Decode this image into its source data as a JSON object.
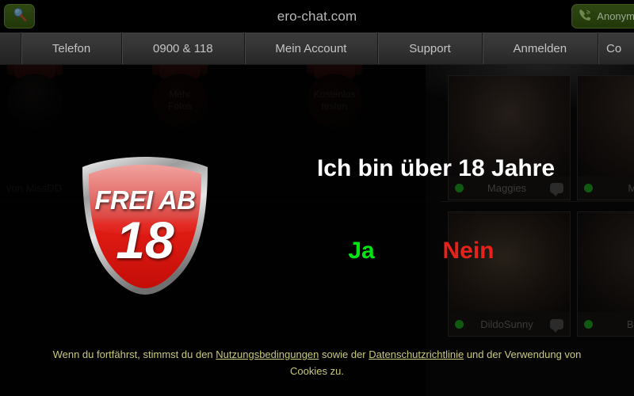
{
  "browser": {
    "title": "ero-chat.com",
    "left_chip": {
      "icon": "search-icon",
      "label": ""
    },
    "right_chip": {
      "icon": "phone-call-icon",
      "label": "Anonym"
    }
  },
  "nav": {
    "items": [
      {
        "label": "Telefon"
      },
      {
        "label": "0900 & 118"
      },
      {
        "label": "Mein Account"
      },
      {
        "label": "Support"
      },
      {
        "label": "Anmelden"
      },
      {
        "label": "Co"
      }
    ]
  },
  "background": {
    "medals": [
      {
        "label": ""
      },
      {
        "label": "Mehr\nFotos"
      },
      {
        "label": "Kostenlos\ntesten"
      }
    ],
    "medal_labels": {
      "m0_line1": "",
      "m1_line1": "Mehr",
      "m1_line2": "Fotos",
      "m2_line1": "Kostenlos",
      "m2_line2": "testen"
    },
    "caption": "von MissDD",
    "cards": [
      {
        "name": "Maggies",
        "status": "online"
      },
      {
        "name": "Mis",
        "status": "online"
      },
      {
        "name": "DildoSunny",
        "status": "online"
      },
      {
        "name": "Bon",
        "status": "online"
      }
    ]
  },
  "age_gate": {
    "badge": {
      "line1": "FREI AB",
      "number": "18"
    },
    "question": "Ich bin über 18 Jahre",
    "yes_label": "Ja",
    "no_label": "Nein",
    "legal": {
      "part1": "Wenn du fortfährst, stimmst du den ",
      "link1": "Nutzungsbedingungen",
      "part2": " sowie der ",
      "link2": "Datenschutzrichtlinie",
      "part3": " und der Verwendung von Cookies zu."
    }
  },
  "colors": {
    "yes": "#00e612",
    "no": "#e8221a",
    "legal_text": "#c9c97c",
    "badge_red": "#e02020",
    "chip_green": "#2e4712",
    "online": "#0f5a10"
  }
}
